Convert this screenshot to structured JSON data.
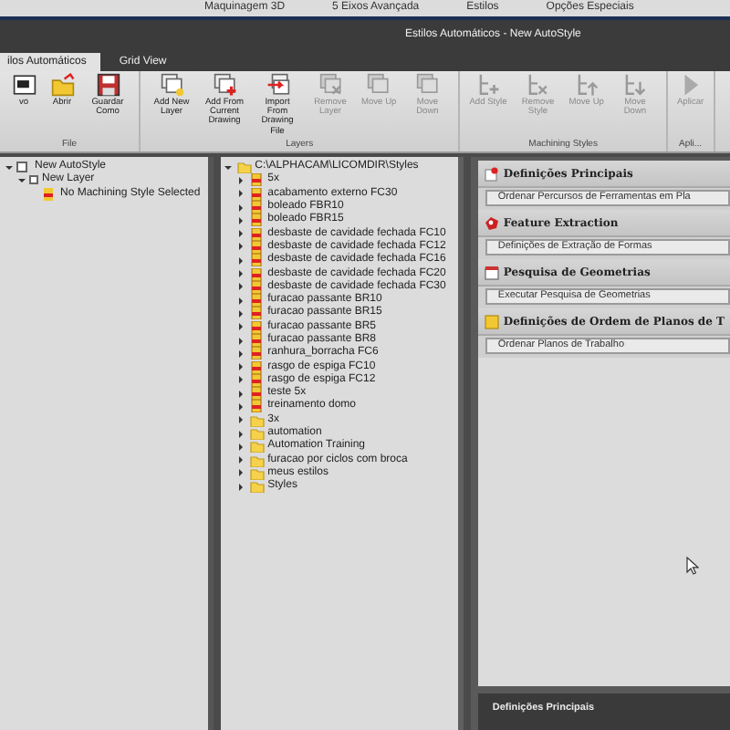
{
  "menu": [
    {
      "label": "Maquinagem 3D"
    },
    {
      "label": "5 Eixos Avançada"
    },
    {
      "label": "Estilos"
    },
    {
      "label": "Opções Especiais"
    }
  ],
  "window": {
    "title": "Estilos Automáticos - New AutoStyle"
  },
  "tabs": [
    {
      "label": "ilos Automáticos",
      "selected": true
    },
    {
      "label": "Grid View",
      "selected": false
    }
  ],
  "toolbar": {
    "groups": [
      {
        "label": "File",
        "buttons": [
          {
            "label": "vo",
            "kind": "new",
            "disabled": false
          },
          {
            "label": "Abrir",
            "kind": "open",
            "disabled": false
          },
          {
            "label": "Guardar Como",
            "kind": "save",
            "disabled": false
          }
        ]
      },
      {
        "label": "Layers",
        "buttons": [
          {
            "label": "Add New Layer",
            "kind": "layer-new",
            "disabled": false
          },
          {
            "label": "Add From Current Drawing",
            "kind": "layer-add",
            "disabled": false
          },
          {
            "label": "Import From Drawing File",
            "kind": "layer-import",
            "disabled": false
          },
          {
            "label": "Remove Layer",
            "kind": "layer-remove",
            "disabled": true
          },
          {
            "label": "Move Up",
            "kind": "layer-up",
            "disabled": true
          },
          {
            "label": "Move Down",
            "kind": "layer-down",
            "disabled": true
          }
        ]
      },
      {
        "label": "Machining Styles",
        "buttons": [
          {
            "label": "Add Style",
            "kind": "style-add",
            "disabled": true
          },
          {
            "label": "Remove Style",
            "kind": "style-remove",
            "disabled": true
          },
          {
            "label": "Move Up",
            "kind": "style-up",
            "disabled": true
          },
          {
            "label": "Move Down",
            "kind": "style-down",
            "disabled": true
          }
        ]
      },
      {
        "label": "Apli...",
        "buttons": [
          {
            "label": "Aplicar",
            "kind": "apply",
            "disabled": true
          }
        ]
      }
    ]
  },
  "layers_tree": [
    {
      "label": "New AutoStyle",
      "kind": "autostyle",
      "expanded": true,
      "children": [
        {
          "label": "New Layer",
          "checked": false,
          "expanded": true,
          "children": [
            {
              "label": "No Machining Style Selected",
              "kind": "style"
            }
          ]
        }
      ]
    }
  ],
  "styles_tree": [
    {
      "label": "C:\\ALPHACAM\\LICOMDIR\\Styles",
      "kind": "folder",
      "expanded": true,
      "children": [
        {
          "label": "5x",
          "kind": "file",
          "expanded": false
        },
        {
          "label": "acabamento externo FC30",
          "kind": "file",
          "expanded": false
        },
        {
          "label": "boleado FBR10",
          "kind": "file",
          "expanded": false
        },
        {
          "label": "boleado FBR15",
          "kind": "file",
          "expanded": false
        },
        {
          "label": "desbaste de cavidade fechada FC10",
          "kind": "file",
          "expanded": false
        },
        {
          "label": "desbaste de cavidade fechada FC12",
          "kind": "file",
          "expanded": false
        },
        {
          "label": "desbaste de cavidade fechada FC16",
          "kind": "file",
          "expanded": false
        },
        {
          "label": "desbaste de cavidade fechada FC20",
          "kind": "file",
          "expanded": false
        },
        {
          "label": "desbaste de cavidade fechada FC30",
          "kind": "file",
          "expanded": false
        },
        {
          "label": "furacao passante BR10",
          "kind": "file",
          "expanded": false
        },
        {
          "label": "furacao passante BR15",
          "kind": "file",
          "expanded": false
        },
        {
          "label": "furacao passante BR5",
          "kind": "file",
          "expanded": false
        },
        {
          "label": "furacao passante BR8",
          "kind": "file",
          "expanded": false
        },
        {
          "label": "ranhura_borracha FC6",
          "kind": "file",
          "expanded": false
        },
        {
          "label": "rasgo de espiga FC10",
          "kind": "file",
          "expanded": false
        },
        {
          "label": "rasgo de espiga FC12",
          "kind": "file",
          "expanded": false
        },
        {
          "label": "teste 5x",
          "kind": "file",
          "expanded": false
        },
        {
          "label": "treinamento domo",
          "kind": "file",
          "expanded": false
        },
        {
          "label": "3x",
          "kind": "folder",
          "expanded": false
        },
        {
          "label": "automation",
          "kind": "folder",
          "expanded": false
        },
        {
          "label": "Automation Training",
          "kind": "folder",
          "expanded": false
        },
        {
          "label": "furacao por ciclos com broca",
          "kind": "folder",
          "expanded": false
        },
        {
          "label": "meus estilos",
          "kind": "folder",
          "expanded": false
        },
        {
          "label": "Styles",
          "kind": "folder",
          "expanded": false
        }
      ]
    }
  ],
  "task_panel": {
    "sections": [
      {
        "title": "Definições Principais",
        "kind": "main",
        "items": [
          {
            "label": "Ordenar Percursos de Ferramentas em Pla"
          }
        ]
      },
      {
        "title": "Feature Extraction",
        "kind": "features",
        "items": [
          {
            "label": "Definições de Extração de Formas"
          }
        ]
      },
      {
        "title": "Pesquisa de Geometrias",
        "kind": "search",
        "items": [
          {
            "label": "Executar Pesquisa de Geometrias"
          }
        ]
      },
      {
        "title": "Definições de Ordem de Planos de T",
        "kind": "planes",
        "items": [
          {
            "label": "Ordenar Planos de Trabalho"
          }
        ]
      }
    ],
    "footer": "Definições Principais"
  }
}
